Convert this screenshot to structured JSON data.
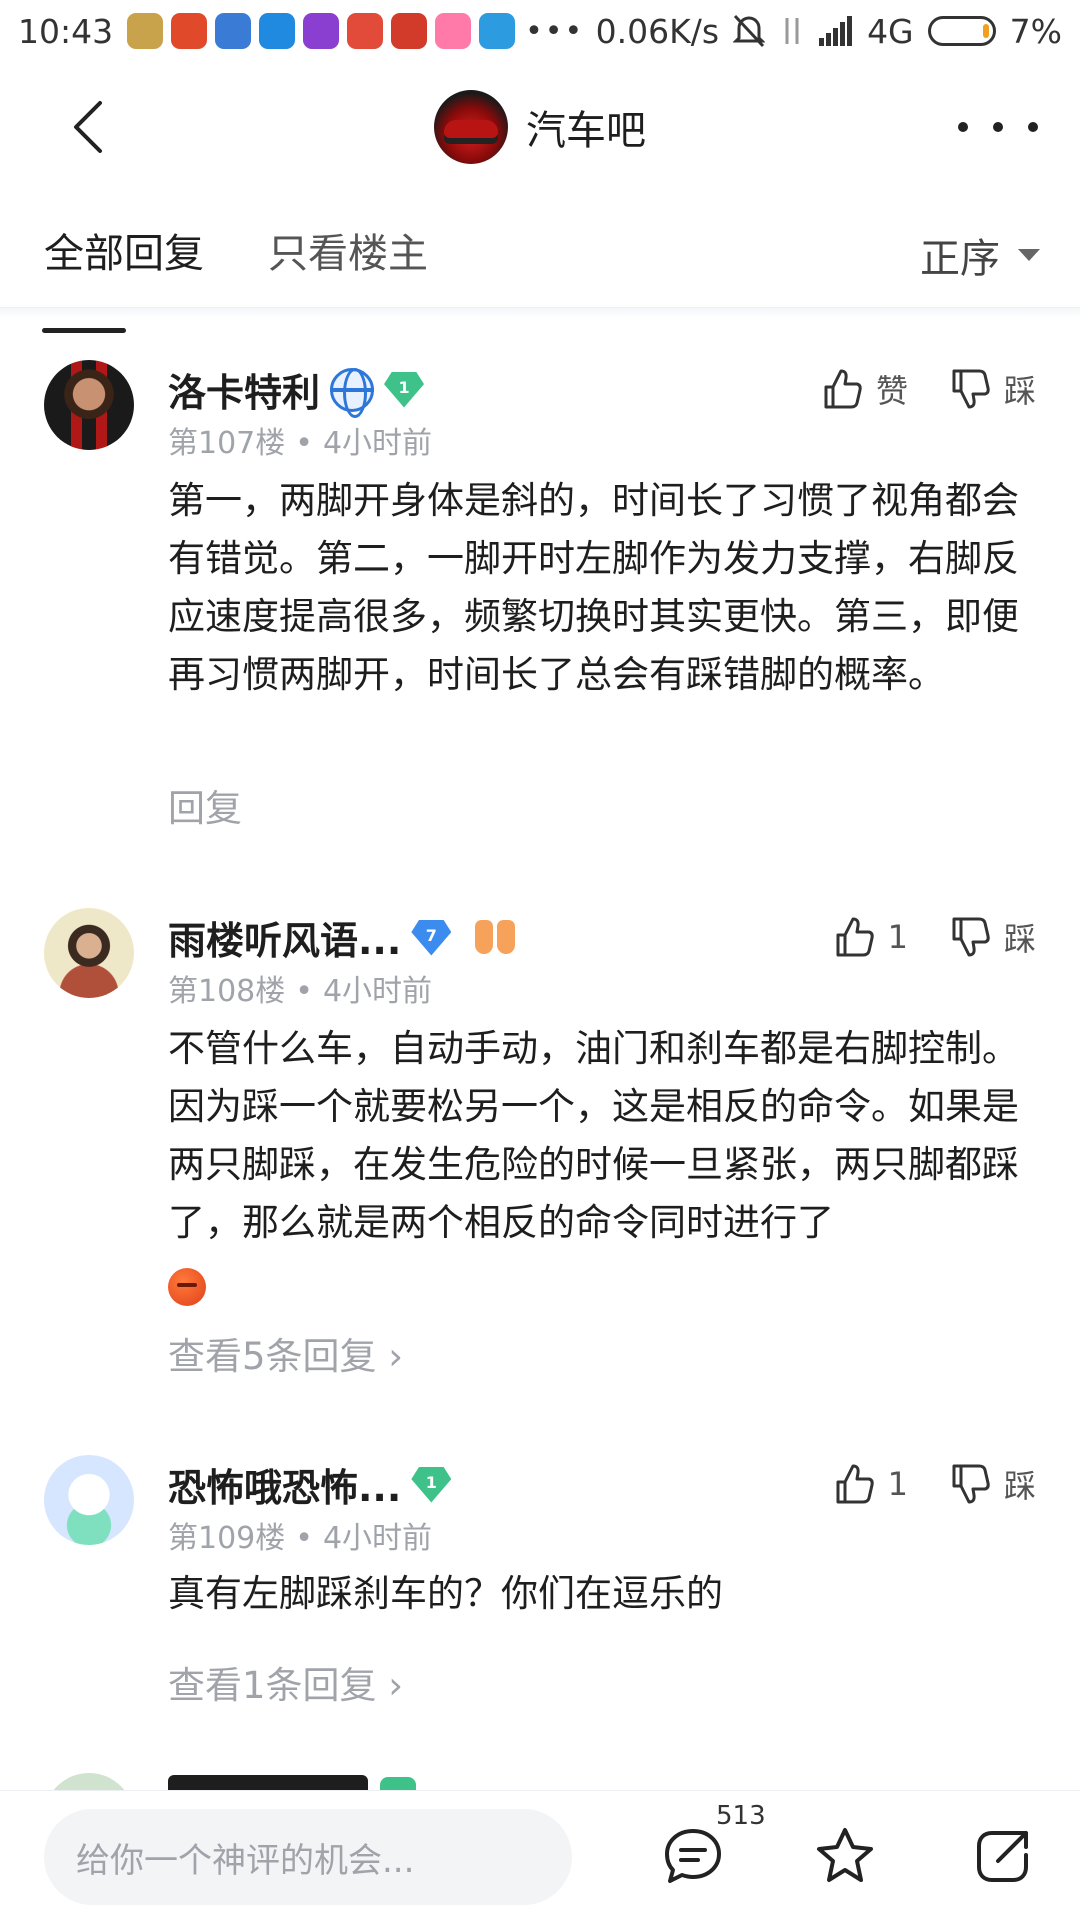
{
  "status_bar": {
    "time": "10:43",
    "more_dots": "•••",
    "net_speed": "0.06K/s",
    "network": "4G",
    "battery": "7%",
    "notification_colors": [
      "#c9a24c",
      "#e04a2a",
      "#3a7bd5",
      "#1f8ae0",
      "#8a3fd1",
      "#e24a3a",
      "#d23a2a",
      "#ff7aa8",
      "#2c9be0"
    ]
  },
  "header": {
    "forum_name": "汽车吧",
    "back_icon": "chevron-left-icon",
    "more_icon": "more-dots-icon"
  },
  "tabs": {
    "items": [
      {
        "label": "全部回复",
        "active": true
      },
      {
        "label": "只看楼主",
        "active": false
      }
    ],
    "sort_label": "正序"
  },
  "comments": [
    {
      "name": "洛卡特利",
      "level": "1",
      "floor": "第107楼",
      "time": "4小时前",
      "text": "第一，两脚开身体是斜的，时间长了习惯了视角都会有错觉。第二，一脚开时左脚作为发力支撑，右脚反应速度提高很多，频繁切换时其实更快。第三，即便再习惯两脚开，时间长了总会有踩错脚的概率。",
      "like_label": "赞",
      "dislike_label": "踩",
      "reply_link": "回复"
    },
    {
      "name": "雨楼听风语...",
      "level": "7",
      "floor": "第108楼",
      "time": "4小时前",
      "text": "不管什么车，自动手动，油门和刹车都是右脚控制。因为踩一个就要松另一个，这是相反的命令。如果是两只脚踩，在发生危险的时候一旦紧张，两只脚都踩了，那么就是两个相反的命令同时进行了",
      "like_label": "1",
      "dislike_label": "踩",
      "reply_link": "查看5条回复 ›"
    },
    {
      "name": "恐怖哦恐怖...",
      "level": "1",
      "floor": "第109楼",
      "time": "4小时前",
      "text": "真有左脚踩刹车的？你们在逗乐的",
      "like_label": "1",
      "dislike_label": "踩",
      "reply_link": "查看1条回复 ›"
    }
  ],
  "meta_separator": "•",
  "bottom_bar": {
    "input_placeholder": "给你一个神评的机会...",
    "comment_count": "513"
  }
}
